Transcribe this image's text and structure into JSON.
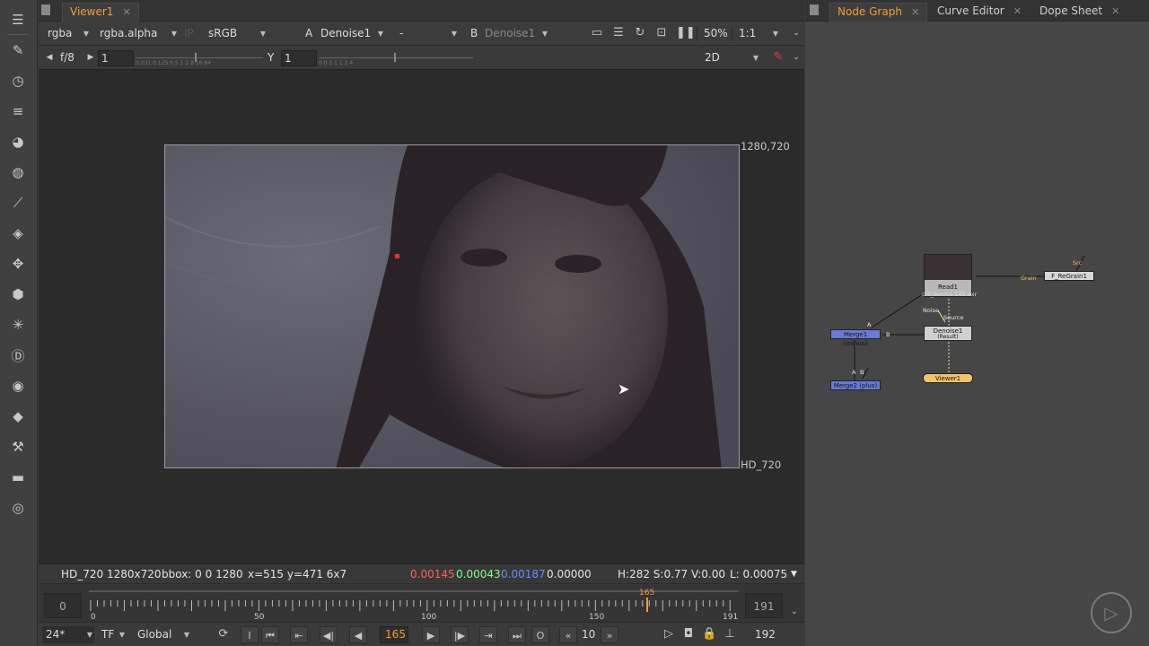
{
  "toolbar": {
    "icons": [
      "menu-icon",
      "paint-brush-icon",
      "clock-icon",
      "channel-icon",
      "color-wheel-icon",
      "sphere-icon",
      "filter-icon",
      "layers-icon",
      "transform-icon",
      "cube-icon",
      "particles-icon",
      "deep-icon",
      "eye-icon",
      "tag-icon",
      "wrench-icon",
      "folder-icon",
      "fire-icon"
    ]
  },
  "viewer": {
    "tab_label": "Viewer1",
    "channels": "rgba",
    "alpha": "rgba.alpha",
    "ip": "IP",
    "colorspace": "sRGB",
    "a_label": "A",
    "a_input": "Denoise1",
    "mode": "-",
    "b_label": "B",
    "b_input": "Denoise1",
    "zoom": "50%",
    "ratio": "1:1",
    "fstop": "f/8",
    "gain_value": "1",
    "y_label": "Y",
    "gamma_value": "1",
    "view_mode": "2D",
    "gain_ticks": "0.031 0.125 0.5   1   2   8   16   64",
    "gamma_ticks": "0   0.5   1   1   2   4"
  },
  "image": {
    "top_right_label": "1280,720",
    "bottom_right_label": "HD_720"
  },
  "info": {
    "format": "HD_720 1280x720",
    "bbox": "bbox: 0 0 1280",
    "coords": "x=515 y=471 6x7",
    "r": "0.00145",
    "g": "0.00043",
    "b": "0.00187",
    "a": "0.00000",
    "hsv": "H:282 S:0.77 V:0.00",
    "lum": "L: 0.00075"
  },
  "timeline": {
    "in_point": "0",
    "out_point": "191",
    "current_frame": "165",
    "ticks": [
      "0",
      "50",
      "100",
      "150",
      "191"
    ]
  },
  "controls": {
    "fps": "24*",
    "time_format": "TF",
    "scope": "Global",
    "in_label": "I",
    "out_label": "O",
    "frame": "165",
    "step": "10",
    "end_frame": "192"
  },
  "nodegraph": {
    "tabs": [
      "Node Graph",
      "Curve Editor",
      "Dope Sheet"
    ],
    "nodes": {
      "read": "Read1",
      "read_file": "cl3_source.165.exr",
      "denoise": "Denoise1",
      "denoise_sub": "(Result)",
      "viewer": "Viewer1",
      "merge1": "Merge1 (minus)",
      "merge2": "Merge2 (plus)",
      "regrain": "F_ReGrain1"
    },
    "edge_labels": {
      "noise": "Noise",
      "source": "Source",
      "grain": "Grain",
      "src": "Src",
      "a1": "A",
      "b1": "B",
      "a2": "A",
      "b2": "B"
    }
  },
  "colors": {
    "accent": "#f0a030",
    "red": "#ff5a5a",
    "green": "#7cff7c",
    "blue": "#6a8cff",
    "merge_node": "#6a7ad8",
    "viewer_node": "#f3c26b"
  }
}
